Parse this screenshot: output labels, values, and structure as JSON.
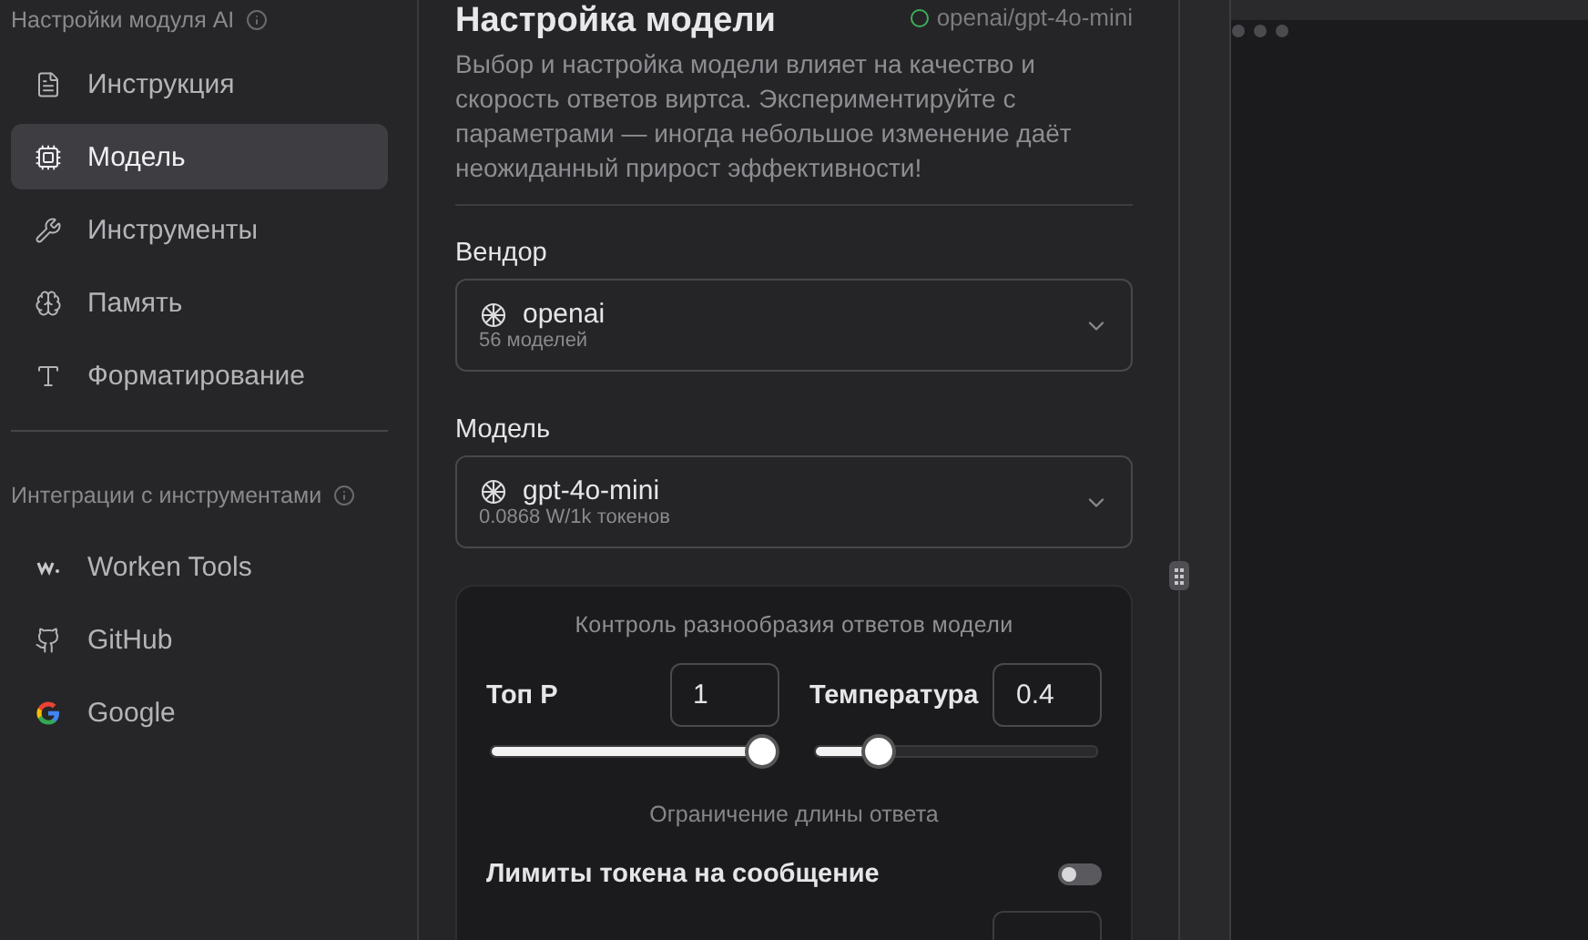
{
  "sidebar": {
    "section_title": "Настройки модуля AI",
    "items": [
      {
        "label": "Инструкция",
        "selected": false
      },
      {
        "label": "Модель",
        "selected": true
      },
      {
        "label": "Инструменты",
        "selected": false
      },
      {
        "label": "Память",
        "selected": false
      },
      {
        "label": "Форматирование",
        "selected": false
      }
    ],
    "integrations_title": "Интеграции с инструментами",
    "integrations": [
      {
        "label": "Worken Tools",
        "selected": false
      },
      {
        "label": "GitHub",
        "selected": false
      },
      {
        "label": "Google",
        "selected": false
      }
    ]
  },
  "main": {
    "title": "Настройка модели",
    "status": "openai/gpt-4o-mini",
    "description": "Выбор и настройка модели влияет на качество и скорость ответов виртса. Экспериментируйте с параметрами — иногда небольшое изменение даёт неожиданный прирост эффективности!",
    "selects": [
      {
        "label": "Вендор",
        "value": "openai",
        "sub": "56 моделей"
      },
      {
        "label": "Модель",
        "value": "gpt-4o-mini",
        "sub": "0.0868 W/1k токенов"
      }
    ],
    "panel": {
      "title": "Контроль разнообразия ответов модели",
      "params": [
        {
          "label": "Топ P",
          "value": "1",
          "level": 1
        },
        {
          "label": "Температура",
          "value": "0.4",
          "level": 0.2
        }
      ],
      "limit_title": "Ограничение длины ответа",
      "toggle": {
        "label": "Лимиты токена на сообщение",
        "on": false
      }
    }
  }
}
